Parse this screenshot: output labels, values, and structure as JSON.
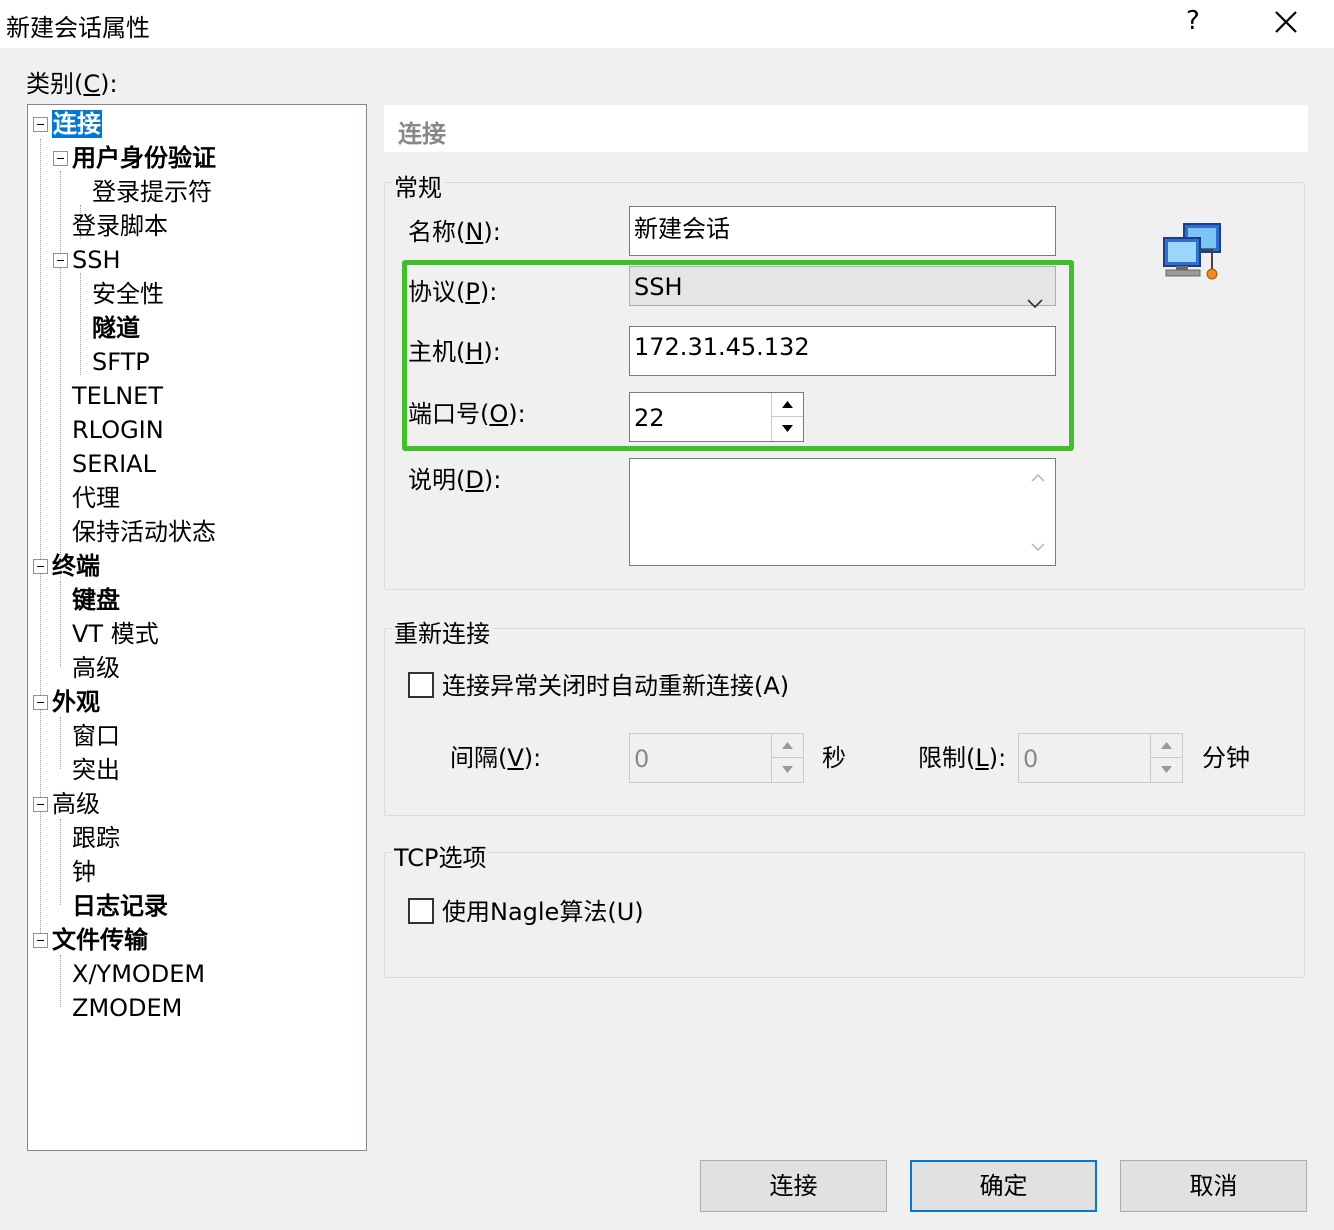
{
  "window": {
    "title": "新建会话属性",
    "help_label": "?",
    "close_icon": "close-icon"
  },
  "category": {
    "label_prefix": "类别(",
    "label_key": "C",
    "label_suffix": "):"
  },
  "tree": {
    "items": [
      {
        "label": "连接",
        "bold": true,
        "selected": true
      },
      {
        "label": "用户身份验证",
        "bold": true
      },
      {
        "label": "登录提示符"
      },
      {
        "label": "登录脚本"
      },
      {
        "label": "SSH"
      },
      {
        "label": "安全性"
      },
      {
        "label": "隧道",
        "bold": true
      },
      {
        "label": "SFTP"
      },
      {
        "label": "TELNET"
      },
      {
        "label": "RLOGIN"
      },
      {
        "label": "SERIAL"
      },
      {
        "label": "代理"
      },
      {
        "label": "保持活动状态"
      },
      {
        "label": "终端",
        "bold": true
      },
      {
        "label": "键盘",
        "bold": true
      },
      {
        "label": "VT 模式"
      },
      {
        "label": "高级"
      },
      {
        "label": "外观",
        "bold": true
      },
      {
        "label": "窗口"
      },
      {
        "label": "突出"
      },
      {
        "label": "高级"
      },
      {
        "label": "跟踪"
      },
      {
        "label": "钟"
      },
      {
        "label": "日志记录",
        "bold": true
      },
      {
        "label": "文件传输",
        "bold": true
      },
      {
        "label": "X/YMODEM"
      },
      {
        "label": "ZMODEM"
      }
    ]
  },
  "panel": {
    "header": "连接",
    "general": {
      "title": "常规",
      "name_label": "名称(N):",
      "name_value": "新建会话",
      "protocol_label": "协议(P):",
      "protocol_value": "SSH",
      "host_label": "主机(H):",
      "host_value": "172.31.45.132",
      "port_label": "端口号(O):",
      "port_value": "22",
      "desc_label": "说明(D):",
      "desc_value": "",
      "network_icon": "network-computers-icon"
    },
    "reconnect": {
      "title": "重新连接",
      "checkbox_label": "连接异常关闭时自动重新连接(A)",
      "checked": false,
      "interval_label": "间隔(V):",
      "interval_value": "0",
      "interval_unit": "秒",
      "limit_label": "限制(L):",
      "limit_value": "0",
      "limit_unit": "分钟"
    },
    "tcp": {
      "title": "TCP选项",
      "checkbox_label": "使用Nagle算法(U)",
      "checked": false
    }
  },
  "buttons": {
    "connect": "连接",
    "ok": "确定",
    "cancel": "取消"
  },
  "colors": {
    "highlight": "#3fc02b",
    "selection": "#0078d7"
  }
}
